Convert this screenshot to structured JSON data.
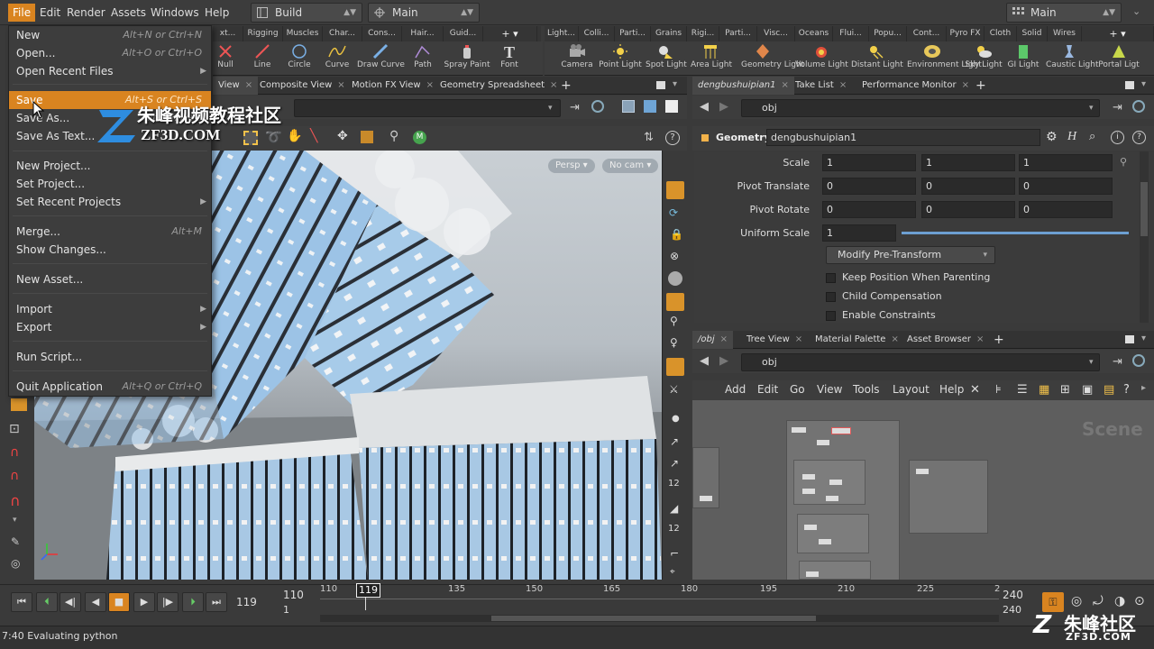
{
  "menubar": {
    "items": [
      "File",
      "Edit",
      "Render",
      "Assets",
      "Windows",
      "Help"
    ],
    "desktop": "Build",
    "context": "Main",
    "right_desktop": "Main"
  },
  "shelf": {
    "left_tabs": [
      "xt...",
      "Rigging",
      "Muscles",
      "Char...",
      "Cons...",
      "Hair...",
      "Guid..."
    ],
    "left_tools": [
      "Null",
      "Line",
      "Circle",
      "Curve",
      "Draw Curve",
      "Path",
      "Spray Paint",
      "Font"
    ],
    "right_tabs": [
      "Light...",
      "Colli...",
      "Parti...",
      "Grains",
      "Rigi...",
      "Parti...",
      "Visc...",
      "Oceans",
      "Flui...",
      "Popu...",
      "Cont...",
      "Pyro FX",
      "Cloth",
      "Solid",
      "Wires"
    ],
    "right_tools": [
      "Camera",
      "Point Light",
      "Spot Light",
      "Area Light",
      "Geometry Light",
      "Volume Light",
      "Distant Light",
      "Environment Light",
      "Sky Light",
      "GI Light",
      "Caustic Light",
      "Portal Ligt"
    ]
  },
  "viewport_panel": {
    "tabs": [
      "View",
      "Composite View",
      "Motion FX View",
      "Geometry Spreadsheet"
    ],
    "persp": "Persp",
    "cam": "No cam"
  },
  "param_panel": {
    "tabs": [
      "dengbushuipian1",
      "Take List",
      "Performance Monitor"
    ],
    "path": "obj",
    "node_type": "Geometry",
    "node_name": "dengbushuipian1",
    "rows": [
      {
        "label": "Scale",
        "values": [
          "1",
          "1",
          "1"
        ]
      },
      {
        "label": "Pivot Translate",
        "values": [
          "0",
          "0",
          "0"
        ]
      },
      {
        "label": "Pivot Rotate",
        "values": [
          "0",
          "0",
          "0"
        ]
      }
    ],
    "uniform_scale_label": "Uniform Scale",
    "uniform_scale": "1",
    "uniform_scale_level": 1.0,
    "modify_menu": "Modify Pre-Transform",
    "checkboxes": [
      "Keep Position When Parenting",
      "Child Compensation",
      "Enable Constraints"
    ]
  },
  "network_panel": {
    "tabs": [
      "/obj",
      "Tree View",
      "Material Palette",
      "Asset Browser"
    ],
    "path": "obj",
    "menu": [
      "Add",
      "Edit",
      "Go",
      "View",
      "Tools",
      "Layout",
      "Help"
    ],
    "watermark": "Scene"
  },
  "file_menu": {
    "items": [
      {
        "label": "New",
        "shortcut": "Alt+N or Ctrl+N"
      },
      {
        "label": "Open...",
        "shortcut": "Alt+O or Ctrl+O"
      },
      {
        "label": "Open Recent Files",
        "shortcut": ""
      },
      {
        "label": "Save",
        "shortcut": "Alt+S or Ctrl+S"
      },
      {
        "label": "Save As...",
        "shortcut": "Alt+Shift+S"
      },
      {
        "label": "Save As Text...",
        "shortcut": ""
      },
      {
        "label": "New Project...",
        "shortcut": ""
      },
      {
        "label": "Set Project...",
        "shortcut": ""
      },
      {
        "label": "Set Recent Projects",
        "shortcut": ""
      },
      {
        "label": "Merge...",
        "shortcut": "Alt+M"
      },
      {
        "label": "Show Changes...",
        "shortcut": ""
      },
      {
        "label": "New Asset...",
        "shortcut": ""
      },
      {
        "label": "Import",
        "shortcut": ""
      },
      {
        "label": "Export",
        "shortcut": ""
      },
      {
        "label": "Run Script...",
        "shortcut": ""
      },
      {
        "label": "Quit Application",
        "shortcut": "Alt+Q or Ctrl+Q"
      }
    ]
  },
  "timeline": {
    "current_frame": "119",
    "range_start": "110",
    "range_start_sub": "1",
    "marker": "119",
    "ticks": [
      "110",
      "135",
      "150",
      "165",
      "180",
      "195",
      "210",
      "225",
      "2"
    ],
    "end_frame": "240",
    "end_frame_sub": "240"
  },
  "status": {
    "message": "7:40 Evaluating python"
  },
  "watermark": {
    "cn": "朱峰视频教程社区",
    "site": "ZF3D.COM",
    "corner_cn": "朱峰社区",
    "corner_site": "ZF3D.COM"
  },
  "colors": {
    "accent": "#d98420",
    "panel": "#3a3a3a",
    "viewport_sky": "#c9cfd4",
    "glass": "#9cc3e6"
  }
}
